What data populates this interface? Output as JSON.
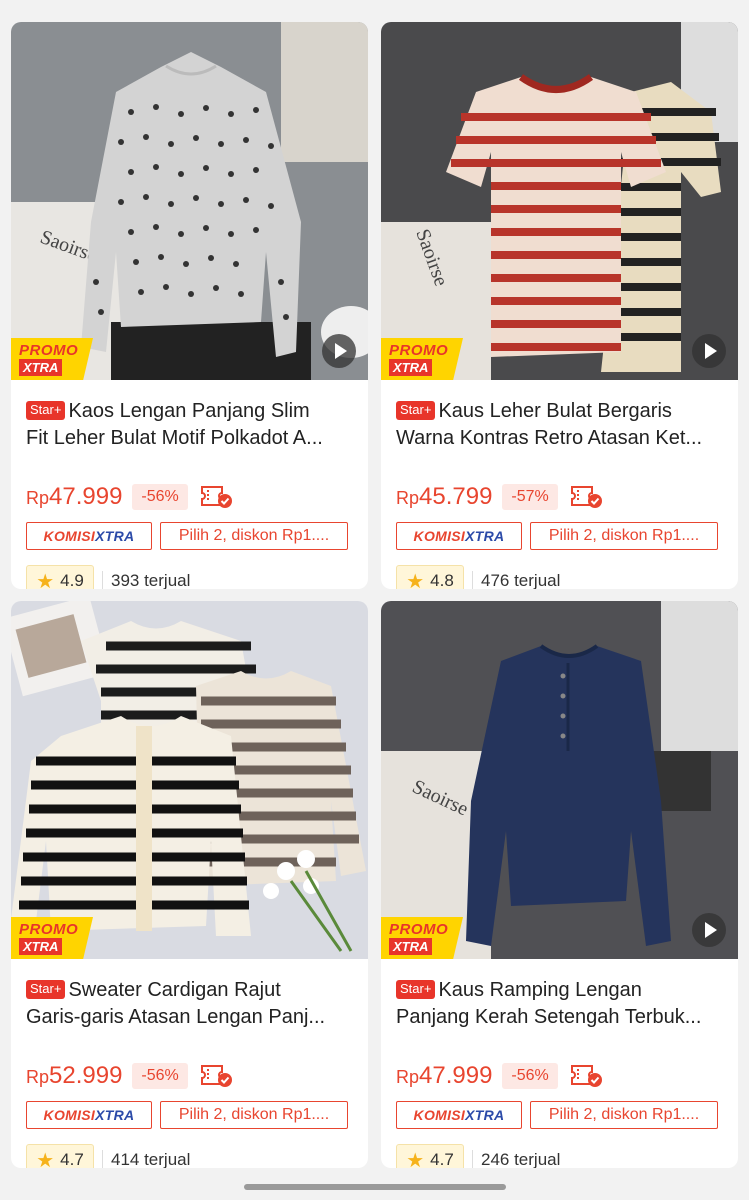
{
  "colors": {
    "accent": "#e8452f",
    "badge": "#e8352a",
    "promo_bg": "#ffd400",
    "komisi_blue": "#2b4aa8"
  },
  "products": [
    {
      "promo": [
        "PROMO",
        "XTRA"
      ],
      "badge": "Star+",
      "title_line1": "Kaos Lengan Panjang Slim",
      "title_line2": "Fit Leher Bulat Motif Polkadot A...",
      "currency": "Rp",
      "price": "47.999",
      "discount": "-56%",
      "komisi_left": "KOMISI",
      "komisi_right": "XTRA",
      "bundle": "Pilih 2, diskon Rp1....",
      "rating": "4.9",
      "sold": "393 terjual",
      "image": "gray-polkadot-long-sleeve"
    },
    {
      "promo": [
        "PROMO",
        "XTRA"
      ],
      "badge": "Star+",
      "title_line1": "Kaus Leher Bulat Bergaris",
      "title_line2": "Warna Kontras Retro Atasan Ket...",
      "currency": "Rp",
      "price": "45.799",
      "discount": "-57%",
      "komisi_left": "KOMISI",
      "komisi_right": "XTRA",
      "bundle": "Pilih 2, diskon Rp1....",
      "rating": "4.8",
      "sold": "476 terjual",
      "image": "red-striped-tee"
    },
    {
      "promo": [
        "PROMO",
        "XTRA"
      ],
      "badge": "Star+",
      "title_line1": "Sweater Cardigan Rajut",
      "title_line2": "Garis-garis Atasan Lengan Panj...",
      "currency": "Rp",
      "price": "52.999",
      "discount": "-56%",
      "komisi_left": "KOMISI",
      "komisi_right": "XTRA",
      "bundle": "Pilih 2, diskon Rp1....",
      "rating": "4.7",
      "sold": "414 terjual",
      "image": "striped-cardigans"
    },
    {
      "promo": [
        "PROMO",
        "XTRA"
      ],
      "badge": "Star+",
      "title_line1": "Kaus Ramping Lengan",
      "title_line2": "Panjang Kerah Setengah Terbuk...",
      "currency": "Rp",
      "price": "47.999",
      "discount": "-56%",
      "komisi_left": "KOMISI",
      "komisi_right": "XTRA",
      "bundle": "Pilih 2, diskon Rp1....",
      "rating": "4.7",
      "sold": "246 terjual",
      "image": "navy-henley-long-sleeve"
    }
  ]
}
